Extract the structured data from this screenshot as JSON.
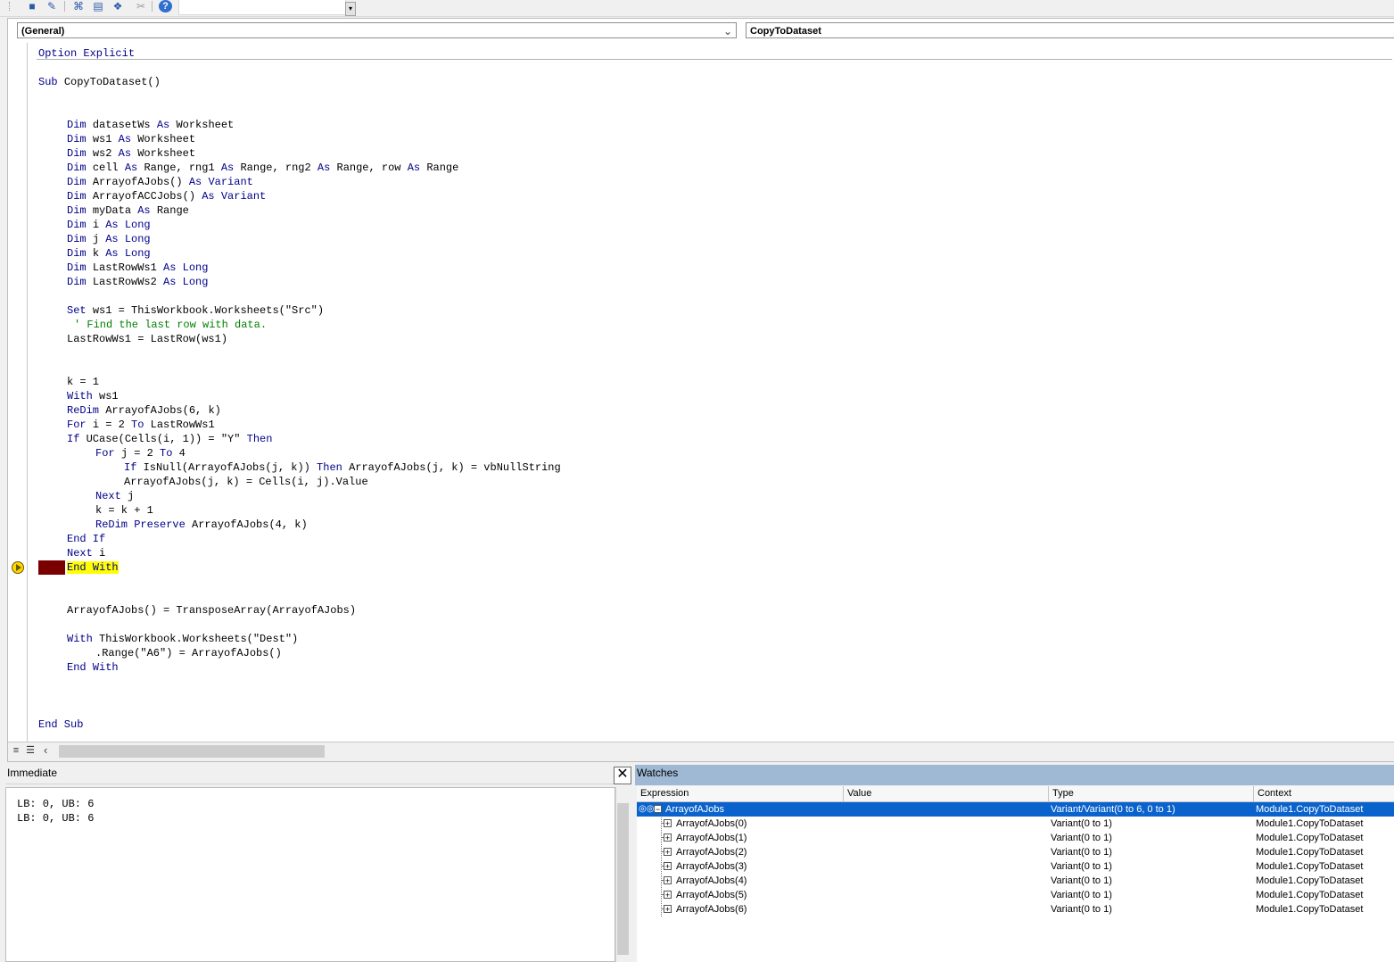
{
  "toolbar": {
    "icons": [
      "stop-icon",
      "design-mode-icon",
      "project-explorer-icon",
      "properties-icon",
      "object-browser-icon",
      "toolbox-icon",
      "help-icon"
    ],
    "help_glyph": "?"
  },
  "module": {
    "object_combo": "(General)",
    "procedure_combo": "CopyToDataset"
  },
  "code": {
    "lines": [
      {
        "row": 0,
        "indent": 0,
        "segments": [
          {
            "t": "Option Explicit",
            "k": "kw"
          }
        ]
      },
      {
        "row": 2,
        "indent": 0,
        "segments": [
          {
            "t": "Sub ",
            "k": "kw"
          },
          {
            "t": "CopyToDataset()",
            "k": ""
          }
        ]
      },
      {
        "row": 5,
        "indent": 4,
        "segments": [
          {
            "t": "Dim ",
            "k": "kw"
          },
          {
            "t": "datasetWs ",
            "k": ""
          },
          {
            "t": "As ",
            "k": "kw"
          },
          {
            "t": "Worksheet",
            "k": ""
          }
        ]
      },
      {
        "row": 6,
        "indent": 4,
        "segments": [
          {
            "t": "Dim ",
            "k": "kw"
          },
          {
            "t": "ws1 ",
            "k": ""
          },
          {
            "t": "As ",
            "k": "kw"
          },
          {
            "t": "Worksheet",
            "k": ""
          }
        ]
      },
      {
        "row": 7,
        "indent": 4,
        "segments": [
          {
            "t": "Dim ",
            "k": "kw"
          },
          {
            "t": "ws2 ",
            "k": ""
          },
          {
            "t": "As ",
            "k": "kw"
          },
          {
            "t": "Worksheet",
            "k": ""
          }
        ]
      },
      {
        "row": 8,
        "indent": 4,
        "segments": [
          {
            "t": "Dim ",
            "k": "kw"
          },
          {
            "t": "cell ",
            "k": ""
          },
          {
            "t": "As ",
            "k": "kw"
          },
          {
            "t": "Range, rng1 ",
            "k": ""
          },
          {
            "t": "As ",
            "k": "kw"
          },
          {
            "t": "Range, rng2 ",
            "k": ""
          },
          {
            "t": "As ",
            "k": "kw"
          },
          {
            "t": "Range, row ",
            "k": ""
          },
          {
            "t": "As ",
            "k": "kw"
          },
          {
            "t": "Range",
            "k": ""
          }
        ]
      },
      {
        "row": 9,
        "indent": 4,
        "segments": [
          {
            "t": "Dim ",
            "k": "kw"
          },
          {
            "t": "ArrayofAJobs() ",
            "k": ""
          },
          {
            "t": "As Variant",
            "k": "kw"
          }
        ]
      },
      {
        "row": 10,
        "indent": 4,
        "segments": [
          {
            "t": "Dim ",
            "k": "kw"
          },
          {
            "t": "ArrayofACCJobs() ",
            "k": ""
          },
          {
            "t": "As Variant",
            "k": "kw"
          }
        ]
      },
      {
        "row": 11,
        "indent": 4,
        "segments": [
          {
            "t": "Dim ",
            "k": "kw"
          },
          {
            "t": "myData ",
            "k": ""
          },
          {
            "t": "As ",
            "k": "kw"
          },
          {
            "t": "Range",
            "k": ""
          }
        ]
      },
      {
        "row": 12,
        "indent": 4,
        "segments": [
          {
            "t": "Dim ",
            "k": "kw"
          },
          {
            "t": "i ",
            "k": ""
          },
          {
            "t": "As Long",
            "k": "kw"
          }
        ]
      },
      {
        "row": 13,
        "indent": 4,
        "segments": [
          {
            "t": "Dim ",
            "k": "kw"
          },
          {
            "t": "j ",
            "k": ""
          },
          {
            "t": "As Long",
            "k": "kw"
          }
        ]
      },
      {
        "row": 14,
        "indent": 4,
        "segments": [
          {
            "t": "Dim ",
            "k": "kw"
          },
          {
            "t": "k ",
            "k": ""
          },
          {
            "t": "As Long",
            "k": "kw"
          }
        ]
      },
      {
        "row": 15,
        "indent": 4,
        "segments": [
          {
            "t": "Dim ",
            "k": "kw"
          },
          {
            "t": "LastRowWs1 ",
            "k": ""
          },
          {
            "t": "As Long",
            "k": "kw"
          }
        ]
      },
      {
        "row": 16,
        "indent": 4,
        "segments": [
          {
            "t": "Dim ",
            "k": "kw"
          },
          {
            "t": "LastRowWs2 ",
            "k": ""
          },
          {
            "t": "As Long",
            "k": "kw"
          }
        ]
      },
      {
        "row": 18,
        "indent": 4,
        "segments": [
          {
            "t": "Set ",
            "k": "kw"
          },
          {
            "t": "ws1 = ThisWorkbook.Worksheets(\"Src\")",
            "k": ""
          }
        ]
      },
      {
        "row": 19,
        "indent": 5,
        "segments": [
          {
            "t": "' Find the last row with data.",
            "k": "cm"
          }
        ]
      },
      {
        "row": 20,
        "indent": 4,
        "segments": [
          {
            "t": "LastRowWs1 = LastRow(ws1)",
            "k": ""
          }
        ]
      },
      {
        "row": 23,
        "indent": 4,
        "segments": [
          {
            "t": "k = 1",
            "k": ""
          }
        ]
      },
      {
        "row": 24,
        "indent": 4,
        "segments": [
          {
            "t": "With ",
            "k": "kw"
          },
          {
            "t": "ws1",
            "k": ""
          }
        ]
      },
      {
        "row": 25,
        "indent": 4,
        "segments": [
          {
            "t": "ReDim ",
            "k": "kw"
          },
          {
            "t": "ArrayofAJobs(6, k)",
            "k": ""
          }
        ]
      },
      {
        "row": 26,
        "indent": 4,
        "segments": [
          {
            "t": "For ",
            "k": "kw"
          },
          {
            "t": "i = 2 ",
            "k": ""
          },
          {
            "t": "To ",
            "k": "kw"
          },
          {
            "t": "LastRowWs1",
            "k": ""
          }
        ]
      },
      {
        "row": 27,
        "indent": 4,
        "segments": [
          {
            "t": "If ",
            "k": "kw"
          },
          {
            "t": "UCase(Cells(i, 1)) = \"Y\" ",
            "k": ""
          },
          {
            "t": "Then",
            "k": "kw"
          }
        ]
      },
      {
        "row": 28,
        "indent": 8,
        "segments": [
          {
            "t": "For ",
            "k": "kw"
          },
          {
            "t": "j = 2 ",
            "k": ""
          },
          {
            "t": "To ",
            "k": "kw"
          },
          {
            "t": "4",
            "k": ""
          }
        ]
      },
      {
        "row": 29,
        "indent": 12,
        "segments": [
          {
            "t": "If ",
            "k": "kw"
          },
          {
            "t": "IsNull(ArrayofAJobs(j, k)) ",
            "k": ""
          },
          {
            "t": "Then ",
            "k": "kw"
          },
          {
            "t": "ArrayofAJobs(j, k) = vbNullString",
            "k": ""
          }
        ]
      },
      {
        "row": 30,
        "indent": 12,
        "segments": [
          {
            "t": "ArrayofAJobs(j, k) = Cells(i, j).Value",
            "k": ""
          }
        ]
      },
      {
        "row": 31,
        "indent": 8,
        "segments": [
          {
            "t": "Next ",
            "k": "kw"
          },
          {
            "t": "j",
            "k": ""
          }
        ]
      },
      {
        "row": 32,
        "indent": 8,
        "segments": [
          {
            "t": "k = k + 1",
            "k": ""
          }
        ]
      },
      {
        "row": 33,
        "indent": 8,
        "segments": [
          {
            "t": "ReDim Preserve ",
            "k": "kw"
          },
          {
            "t": "ArrayofAJobs(4, k)",
            "k": ""
          }
        ]
      },
      {
        "row": 34,
        "indent": 4,
        "segments": [
          {
            "t": "End If",
            "k": "kw"
          }
        ]
      },
      {
        "row": 35,
        "indent": 4,
        "segments": [
          {
            "t": "Next ",
            "k": "kw"
          },
          {
            "t": "i",
            "k": ""
          }
        ]
      },
      {
        "row": 36,
        "indent": 4,
        "highlight": true,
        "segments": [
          {
            "t": "End With",
            "k": "hlkw"
          }
        ]
      },
      {
        "row": 39,
        "indent": 4,
        "segments": [
          {
            "t": "ArrayofAJobs() = TransposeArray(ArrayofAJobs)",
            "k": ""
          }
        ]
      },
      {
        "row": 41,
        "indent": 4,
        "segments": [
          {
            "t": "With ",
            "k": "kw"
          },
          {
            "t": "ThisWorkbook.Worksheets(\"Dest\")",
            "k": ""
          }
        ]
      },
      {
        "row": 42,
        "indent": 8,
        "segments": [
          {
            "t": ".Range(\"A6\") = ArrayofAJobs()",
            "k": ""
          }
        ]
      },
      {
        "row": 43,
        "indent": 4,
        "segments": [
          {
            "t": "End With",
            "k": "kw"
          }
        ]
      },
      {
        "row": 47,
        "indent": 0,
        "segments": [
          {
            "t": "End Sub",
            "k": "kw"
          }
        ]
      }
    ],
    "current_row": 36
  },
  "immediate": {
    "title": "Immediate",
    "close_glyph": "✕",
    "lines": [
      "LB: 0, UB: 6",
      "LB: 0, UB: 6"
    ]
  },
  "watches": {
    "title": "Watches",
    "columns": [
      "Expression",
      "Value",
      "Type",
      "Context"
    ],
    "rows": [
      {
        "expression": "ArrayofAJobs",
        "value": "",
        "type": "Variant/Variant(0 to 6, 0 to 1)",
        "context": "Module1.CopyToDataset",
        "level": 0,
        "expanded": true,
        "selected": true
      },
      {
        "expression": "ArrayofAJobs(0)",
        "value": "",
        "type": "Variant(0 to 1)",
        "context": "Module1.CopyToDataset",
        "level": 1,
        "expanded": false,
        "selected": false
      },
      {
        "expression": "ArrayofAJobs(1)",
        "value": "",
        "type": "Variant(0 to 1)",
        "context": "Module1.CopyToDataset",
        "level": 1,
        "expanded": false,
        "selected": false
      },
      {
        "expression": "ArrayofAJobs(2)",
        "value": "",
        "type": "Variant(0 to 1)",
        "context": "Module1.CopyToDataset",
        "level": 1,
        "expanded": false,
        "selected": false
      },
      {
        "expression": "ArrayofAJobs(3)",
        "value": "",
        "type": "Variant(0 to 1)",
        "context": "Module1.CopyToDataset",
        "level": 1,
        "expanded": false,
        "selected": false
      },
      {
        "expression": "ArrayofAJobs(4)",
        "value": "",
        "type": "Variant(0 to 1)",
        "context": "Module1.CopyToDataset",
        "level": 1,
        "expanded": false,
        "selected": false
      },
      {
        "expression": "ArrayofAJobs(5)",
        "value": "",
        "type": "Variant(0 to 1)",
        "context": "Module1.CopyToDataset",
        "level": 1,
        "expanded": false,
        "selected": false
      },
      {
        "expression": "ArrayofAJobs(6)",
        "value": "",
        "type": "Variant(0 to 1)",
        "context": "Module1.CopyToDataset",
        "level": 1,
        "expanded": false,
        "selected": false
      }
    ]
  }
}
